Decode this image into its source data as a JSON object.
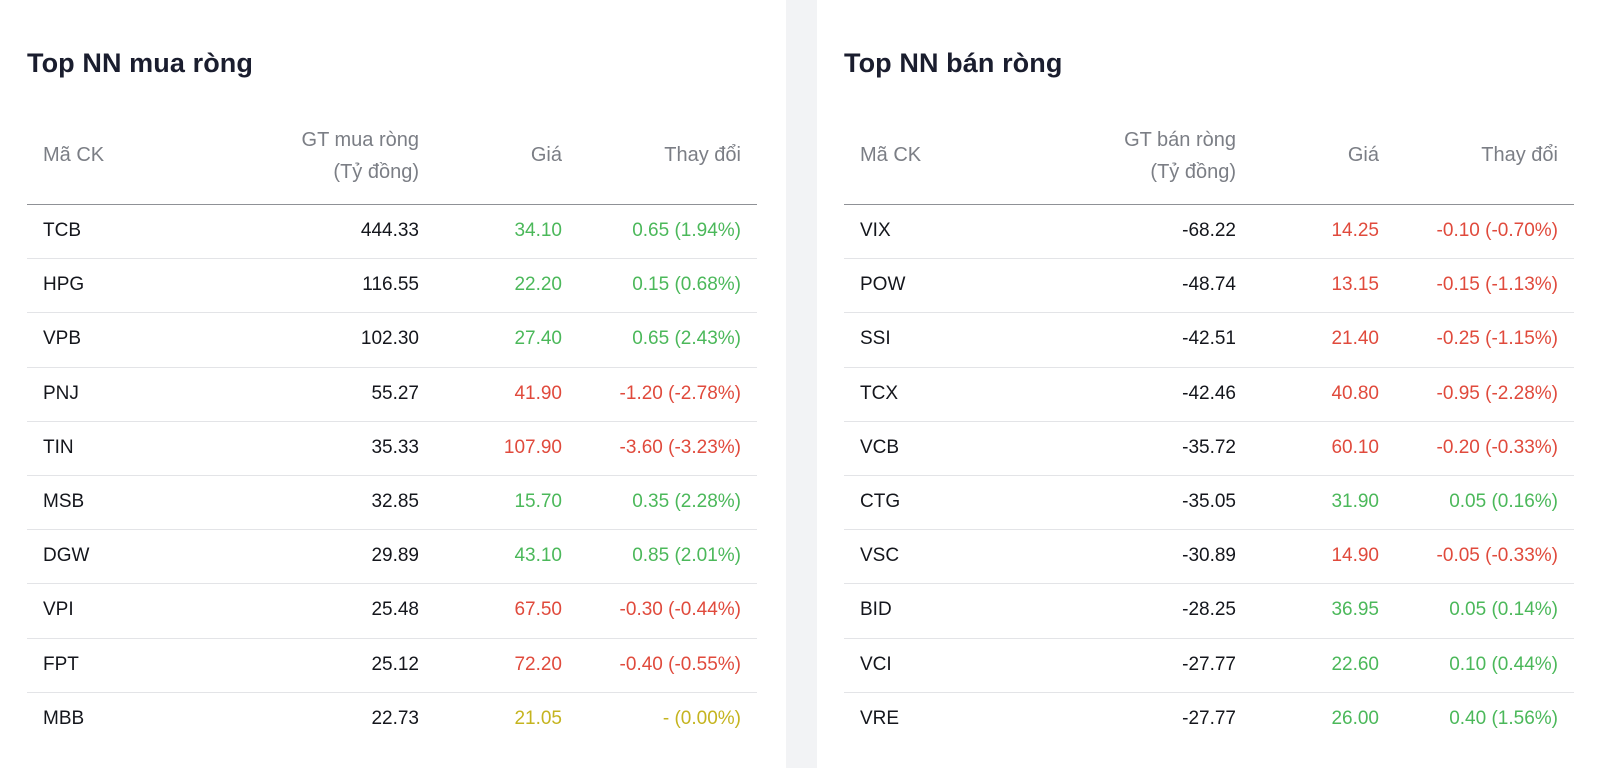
{
  "buy_panel": {
    "title": "Top NN mua ròng",
    "headers": {
      "code": "Mã CK",
      "value_line1": "GT mua ròng",
      "value_line2": "(Tỷ đồng)",
      "price": "Giá",
      "change": "Thay đổi"
    },
    "rows": [
      {
        "code": "TCB",
        "value": "444.33",
        "price": "34.10",
        "change": "0.65 (1.94%)",
        "trend": "up"
      },
      {
        "code": "HPG",
        "value": "116.55",
        "price": "22.20",
        "change": "0.15 (0.68%)",
        "trend": "up"
      },
      {
        "code": "VPB",
        "value": "102.30",
        "price": "27.40",
        "change": "0.65 (2.43%)",
        "trend": "up"
      },
      {
        "code": "PNJ",
        "value": "55.27",
        "price": "41.90",
        "change": "-1.20 (-2.78%)",
        "trend": "down"
      },
      {
        "code": "TIN",
        "value": "35.33",
        "price": "107.90",
        "change": "-3.60 (-3.23%)",
        "trend": "down"
      },
      {
        "code": "MSB",
        "value": "32.85",
        "price": "15.70",
        "change": "0.35 (2.28%)",
        "trend": "up"
      },
      {
        "code": "DGW",
        "value": "29.89",
        "price": "43.10",
        "change": "0.85 (2.01%)",
        "trend": "up"
      },
      {
        "code": "VPI",
        "value": "25.48",
        "price": "67.50",
        "change": "-0.30 (-0.44%)",
        "trend": "down"
      },
      {
        "code": "FPT",
        "value": "25.12",
        "price": "72.20",
        "change": "-0.40 (-0.55%)",
        "trend": "down"
      },
      {
        "code": "MBB",
        "value": "22.73",
        "price": "21.05",
        "change": "- (0.00%)",
        "trend": "ref"
      }
    ]
  },
  "sell_panel": {
    "title": "Top NN bán ròng",
    "headers": {
      "code": "Mã CK",
      "value_line1": "GT bán ròng",
      "value_line2": "(Tỷ đồng)",
      "price": "Giá",
      "change": "Thay đổi"
    },
    "rows": [
      {
        "code": "VIX",
        "value": "-68.22",
        "price": "14.25",
        "change": "-0.10 (-0.70%)",
        "trend": "down"
      },
      {
        "code": "POW",
        "value": "-48.74",
        "price": "13.15",
        "change": "-0.15 (-1.13%)",
        "trend": "down"
      },
      {
        "code": "SSI",
        "value": "-42.51",
        "price": "21.40",
        "change": "-0.25 (-1.15%)",
        "trend": "down"
      },
      {
        "code": "TCX",
        "value": "-42.46",
        "price": "40.80",
        "change": "-0.95 (-2.28%)",
        "trend": "down"
      },
      {
        "code": "VCB",
        "value": "-35.72",
        "price": "60.10",
        "change": "-0.20 (-0.33%)",
        "trend": "down"
      },
      {
        "code": "CTG",
        "value": "-35.05",
        "price": "31.90",
        "change": "0.05 (0.16%)",
        "trend": "up"
      },
      {
        "code": "VSC",
        "value": "-30.89",
        "price": "14.90",
        "change": "-0.05 (-0.33%)",
        "trend": "down"
      },
      {
        "code": "BID",
        "value": "-28.25",
        "price": "36.95",
        "change": "0.05 (0.14%)",
        "trend": "up"
      },
      {
        "code": "VCI",
        "value": "-27.77",
        "price": "22.60",
        "change": "0.10 (0.44%)",
        "trend": "up"
      },
      {
        "code": "VRE",
        "value": "-27.77",
        "price": "26.00",
        "change": "0.40 (1.56%)",
        "trend": "up"
      }
    ]
  },
  "colors": {
    "up": "#4bb85a",
    "down": "#e04a3c",
    "ref": "#c5b41f"
  }
}
